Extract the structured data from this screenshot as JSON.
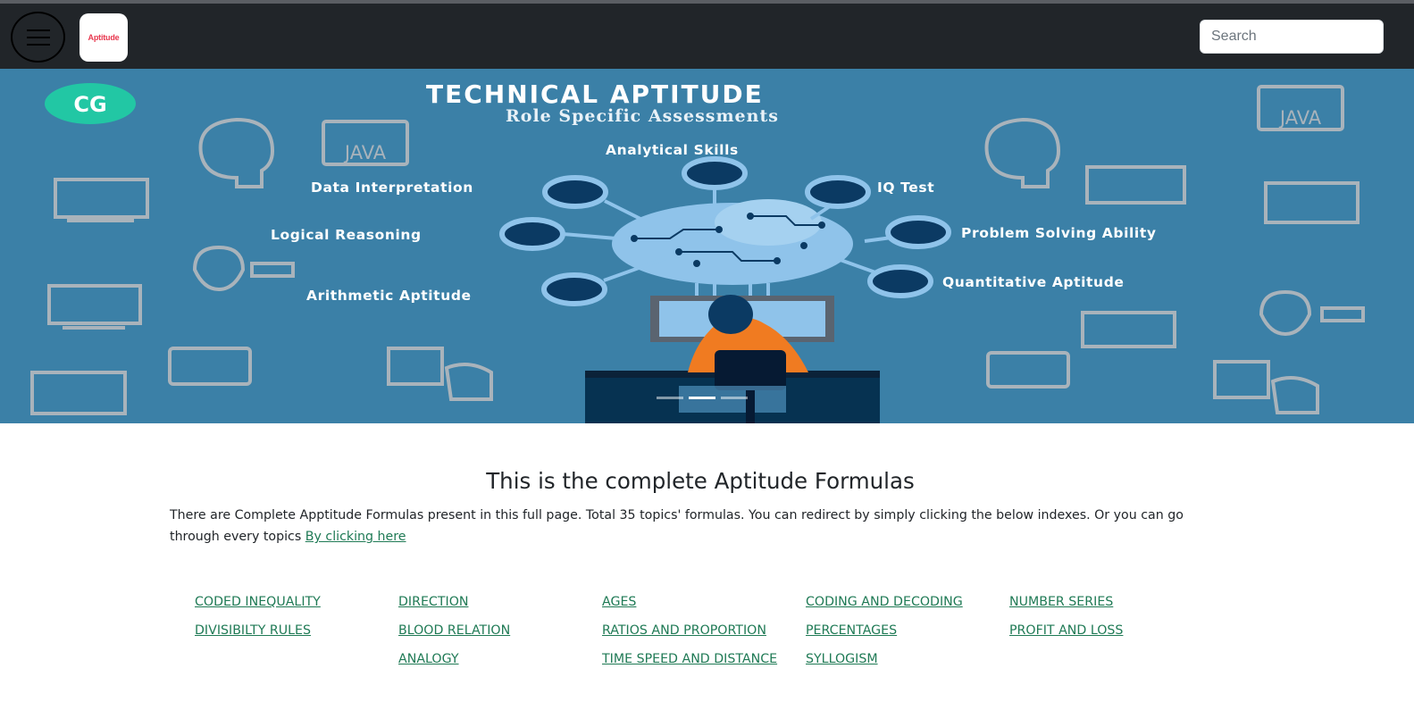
{
  "navbar": {
    "menu_icon": "hamburger-icon",
    "logo_text": "Aptitude",
    "search_placeholder": "Search"
  },
  "hero": {
    "badge": "CG",
    "title": "TECHNICAL APTITUDE",
    "subtitle": "Role Specific Assessments",
    "labels": {
      "analytical": "Analytical Skills",
      "data": "Data Interpretation",
      "iq": "IQ Test",
      "logical": "Logical Reasoning",
      "problem": "Problem Solving Ability",
      "arithmetic": "Arithmetic Aptitude",
      "quantitative": "Quantitative Aptitude"
    },
    "icon_text": "JAVA",
    "slides": 3,
    "active_slide": 2
  },
  "main": {
    "heading": "This is the complete Aptitude Formulas",
    "paragraph": "There are Complete Apptitude Formulas present in this full page. Total 35 topics' formulas. You can redirect by simply clicking the below indexes. Or you can go through every topics ",
    "link_text": "By clicking here",
    "columns": [
      [
        "CODED INEQUALITY",
        "DIVISIBILTY RULES"
      ],
      [
        "DIRECTION",
        "BLOOD RELATION",
        "ANALOGY"
      ],
      [
        "AGES",
        "RATIOS AND PROPORTION",
        "TIME SPEED AND DISTANCE"
      ],
      [
        "CODING AND DECODING",
        "PERCENTAGES",
        "SYLLOGISM"
      ],
      [
        "NUMBER SERIES",
        "PROFIT AND LOSS"
      ]
    ]
  },
  "colors": {
    "navbar": "#212529",
    "hero_bg": "#3b80a7",
    "link": "#1f7a55",
    "node_fill": "#0b3a63",
    "node_ring": "#8fc3ea"
  }
}
